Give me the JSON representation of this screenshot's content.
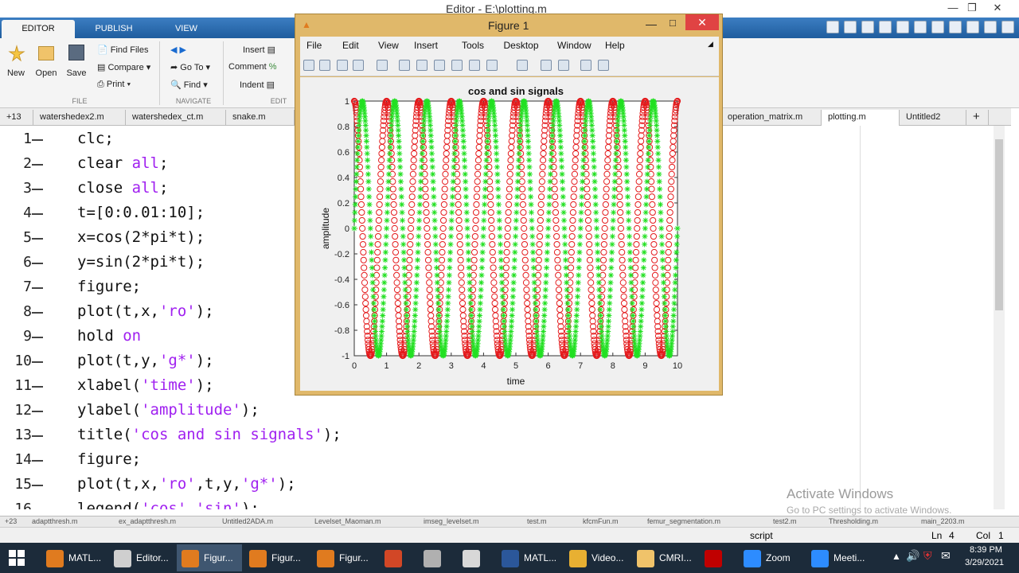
{
  "window": {
    "title": "Editor - E:\\plotting.m"
  },
  "ribbon": {
    "tabs": [
      "EDITOR",
      "PUBLISH",
      "VIEW"
    ],
    "new_label": "New",
    "open_label": "Open",
    "save_label": "Save",
    "find_files": "Find Files",
    "compare": "Compare",
    "print": "Print",
    "goto": "Go To",
    "find": "Find",
    "insert": "Insert",
    "comment": "Comment",
    "indent": "Indent",
    "group_file": "FILE",
    "group_navigate": "NAVIGATE",
    "group_edit": "EDIT"
  },
  "editor_tabs": {
    "overflow_count": "+13",
    "tabs": [
      "watershedex2.m",
      "watershedex_ct.m",
      "snake.m",
      "operation_matrix.m",
      "plotting.m",
      "Untitled2"
    ],
    "active": "plotting.m",
    "add": "+"
  },
  "code": {
    "lines": [
      {
        "n": "1",
        "text": "clc;"
      },
      {
        "n": "2",
        "text": "clear all;"
      },
      {
        "n": "3",
        "text": "close all;"
      },
      {
        "n": "4",
        "text": "t=[0:0.01:10];"
      },
      {
        "n": "5",
        "text": "x=cos(2*pi*t);"
      },
      {
        "n": "6",
        "text": "y=sin(2*pi*t);"
      },
      {
        "n": "7",
        "text": "figure;"
      },
      {
        "n": "8",
        "text": "plot(t,x,'ro');"
      },
      {
        "n": "9",
        "text": "hold on"
      },
      {
        "n": "10",
        "text": "plot(t,y,'g*');"
      },
      {
        "n": "11",
        "text": "xlabel('time');"
      },
      {
        "n": "12",
        "text": "ylabel('amplitude');"
      },
      {
        "n": "13",
        "text": "title('cos and sin signals');"
      },
      {
        "n": "14",
        "text": "figure;"
      },
      {
        "n": "15",
        "text": "plot(t,x,'ro',t,y,'g*');"
      },
      {
        "n": "16",
        "text": "legend('cos','sin');"
      }
    ],
    "colors": {
      "keyword": "#1e1e1e",
      "string": "#a020f0",
      "text": "#111111"
    }
  },
  "watermark": {
    "line1": "Activate Windows",
    "line2": "Go to PC settings to activate Windows."
  },
  "bottom_tabs": {
    "overflow_count": "+23",
    "tabs": [
      "adaptthresh.m",
      "ex_adaptthresh.m",
      "Untitled2ADA.m",
      "Levelset_Maoman.m",
      "imseg_levelset.m",
      "test.m",
      "kfcmFun.m",
      "femur_segmentation.m",
      "test2.m",
      "Thresholding.m",
      "main_2203.m"
    ]
  },
  "status": {
    "mode": "script",
    "ln_label": "Ln",
    "ln": "4",
    "col_label": "Col",
    "col": "1"
  },
  "figure": {
    "title": "Figure 1",
    "menu": [
      "File",
      "Edit",
      "View",
      "Insert",
      "Tools",
      "Desktop",
      "Window",
      "Help"
    ],
    "toolbar_icons": [
      "new-icon",
      "open-icon",
      "save-icon",
      "print-icon",
      "pointer-icon",
      "zoom-in-icon",
      "zoom-out-icon",
      "pan-icon",
      "rotate-icon",
      "datacursor-icon",
      "brush-icon",
      "link-icon",
      "colorbar-icon",
      "legend-icon",
      "hide-tools-icon",
      "show-tools-icon"
    ]
  },
  "chart_data": {
    "type": "scatter",
    "title": "cos and sin signals",
    "xlabel": "time",
    "ylabel": "amplitude",
    "xlim": [
      0,
      10
    ],
    "ylim": [
      -1,
      1
    ],
    "xticks": [
      0,
      1,
      2,
      3,
      4,
      5,
      6,
      7,
      8,
      9,
      10
    ],
    "yticks": [
      -1,
      -0.8,
      -0.6,
      -0.4,
      -0.2,
      0,
      0.2,
      0.4,
      0.6,
      0.8,
      1
    ],
    "x_range": {
      "start": 0,
      "stop": 10,
      "step": 0.01
    },
    "series": [
      {
        "formula": "cos(2*pi*t)",
        "marker": "o",
        "color": "#e41a1c"
      },
      {
        "formula": "sin(2*pi*t)",
        "marker": "*",
        "color": "#22e022"
      }
    ],
    "grid": false
  },
  "taskbar": {
    "items": [
      {
        "label": "MATL...",
        "color": "#e07b1f"
      },
      {
        "label": "Editor...",
        "color": "#cfcfcf"
      },
      {
        "label": "Figur...",
        "color": "#e07b1f"
      },
      {
        "label": "Figur...",
        "color": "#e07b1f"
      },
      {
        "label": "Figur...",
        "color": "#e07b1f"
      },
      {
        "label": "",
        "color": "#d24726"
      },
      {
        "label": "",
        "color": "#b0b0b0"
      },
      {
        "label": "",
        "color": "#d8d8d8"
      },
      {
        "label": "MATL...",
        "color": "#2b579a"
      },
      {
        "label": "Video...",
        "color": "#e8b032"
      },
      {
        "label": "CMRI...",
        "color": "#f0c36a"
      },
      {
        "label": "",
        "color": "#c00000"
      },
      {
        "label": "Zoom",
        "color": "#2d8cff"
      },
      {
        "label": "Meeti...",
        "color": "#2d8cff"
      }
    ],
    "time": "8:39 PM",
    "date": "3/29/2021"
  }
}
